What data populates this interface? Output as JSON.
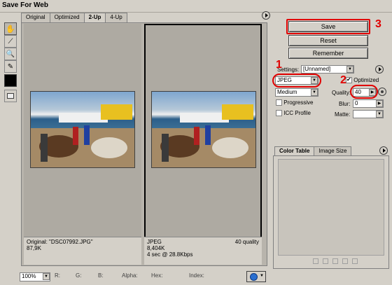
{
  "window": {
    "title": "Save For Web"
  },
  "tabs": [
    "Original",
    "Optimized",
    "2-Up",
    "4-Up"
  ],
  "active_tab": "2-Up",
  "panes": {
    "original": {
      "line1": "Original: \"DSC07992.JPG\"",
      "line2": "87,9K"
    },
    "optimized": {
      "line1": "JPEG",
      "line2": "8,404K",
      "line3": "4 sec @ 28.8Kbps",
      "quality_note": "40 quality"
    }
  },
  "buttons": {
    "save": "Save",
    "reset": "Reset",
    "remember": "Remember"
  },
  "settings": {
    "label": "Settings:",
    "preset": "[Unnamed]",
    "format": "JPEG",
    "optimized_label": "Optimized",
    "quality_level": "Medium",
    "quality_label": "Quality:",
    "quality_value": "40",
    "progressive_label": "Progressive",
    "blur_label": "Blur:",
    "blur_value": "0",
    "icc_label": "ICC Profile",
    "matte_label": "Matte:"
  },
  "annotations": [
    "1",
    "2",
    "3"
  ],
  "color_panel": {
    "tab1": "Color Table",
    "tab2": "Image Size"
  },
  "statusbar": {
    "zoom": "100%",
    "r": "R:",
    "g": "G:",
    "b": "B:",
    "alpha": "Alpha:",
    "hex": "Hex:",
    "index": "Index:"
  },
  "colors": {
    "annotation_red": "#e00000"
  }
}
